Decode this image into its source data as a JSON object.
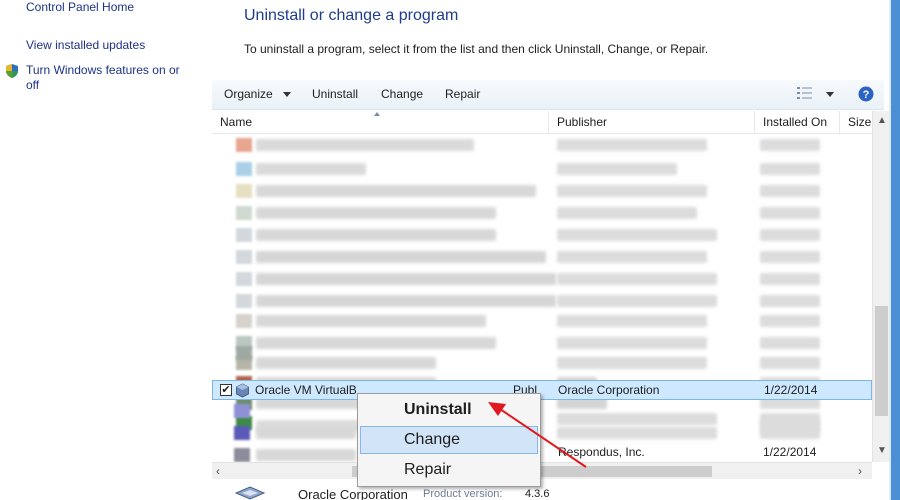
{
  "left_pane": {
    "control_panel_home": "Control Panel Home",
    "view_installed_updates": "View installed updates",
    "turn_features_line1": "Turn Windows features on or",
    "turn_features_line2": "off"
  },
  "header": {
    "title": "Uninstall or change a program",
    "description": "To uninstall a program, select it from the list and then click Uninstall, Change, or Repair."
  },
  "toolbar": {
    "organize": "Organize",
    "uninstall": "Uninstall",
    "change": "Change",
    "repair": "Repair",
    "view_icon": "view-options-icon",
    "help_icon": "help-icon"
  },
  "columns": {
    "name": "Name",
    "publisher": "Publisher",
    "installed_on": "Installed On",
    "size": "Size"
  },
  "selected_row": {
    "name": "Oracle VM VirtualB",
    "publisher_prefix": "Publ",
    "publisher": "Oracle Corporation",
    "installed_on": "1/22/2014"
  },
  "bottom_row": {
    "publisher": "Respondus, Inc.",
    "installed_on": "1/22/2014"
  },
  "context_menu": {
    "uninstall": "Uninstall",
    "change": "Change",
    "repair": "Repair"
  },
  "details": {
    "publisher": "Oracle Corporation",
    "product_version_label": "Product version:",
    "product_version": "4.3.6"
  },
  "colors": {
    "accent_blue": "#1e3d8c",
    "selection_bg": "#cde8ff",
    "menu_hover": "#d2e4f7",
    "arrow_red": "#e0181f"
  }
}
